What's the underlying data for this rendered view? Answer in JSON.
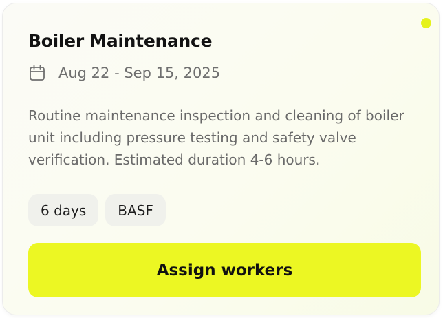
{
  "card": {
    "title": "Boiler Maintenance",
    "date_icon": "calendar-icon",
    "date_range": "Aug 22 - Sep 15, 2025",
    "description": "Routine maintenance inspection and cleaning of boiler unit including pressure testing and safety valve verification. Estimated duration 4-6 hours.",
    "tags": [
      {
        "label": "6 days"
      },
      {
        "label": "BASF"
      }
    ],
    "assign_label": "Assign workers"
  },
  "colors": {
    "accent": "#ecf723",
    "status_dot": "#e5f21c"
  }
}
